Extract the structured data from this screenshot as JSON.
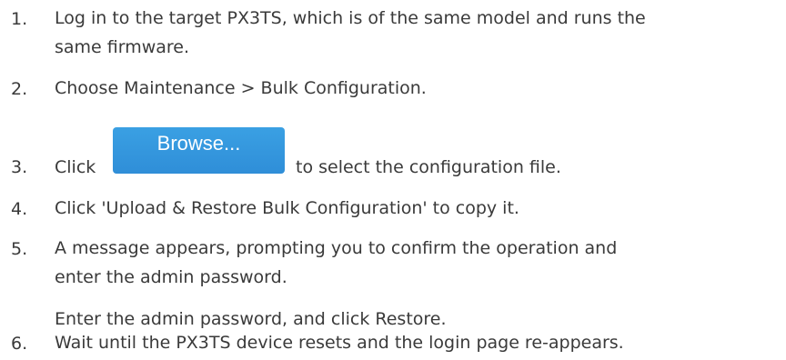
{
  "steps": [
    {
      "number": "1.",
      "lines": [
        "Log in to the target PX3TS, which is of the same model and runs the",
        "same firmware."
      ]
    },
    {
      "number": "2.",
      "lines": [
        "Choose Maintenance > Bulk Configuration."
      ]
    },
    {
      "number": "3.",
      "before": "Click",
      "button_label": "Browse...",
      "after": "to select the configuration file."
    },
    {
      "number": "4.",
      "lines": [
        "Click 'Upload & Restore Bulk Configuration' to copy it."
      ]
    },
    {
      "number": "5.",
      "lines": [
        "A message appears, prompting you to confirm the operation and",
        "enter the admin password."
      ],
      "note": "Enter the admin password, and click Restore."
    },
    {
      "number": "6.",
      "lines": [
        "Wait until the PX3TS device resets and the login page re-appears."
      ]
    }
  ],
  "colors": {
    "text": "#3a3a3a",
    "button": "#3399e0",
    "button_text": "#ffffff"
  }
}
